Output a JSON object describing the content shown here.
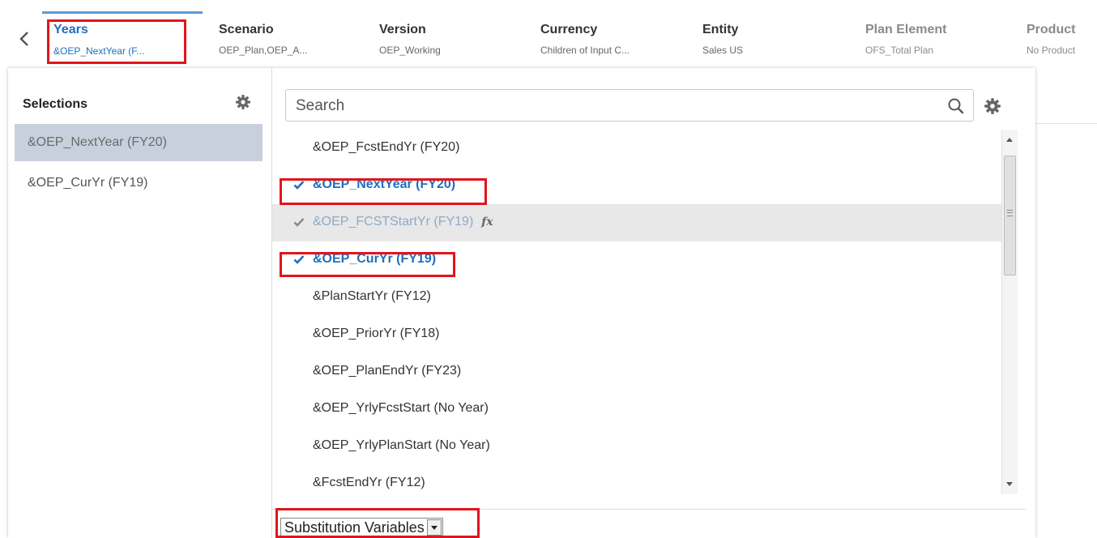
{
  "dimensions": [
    {
      "name": "Years",
      "value": "&OEP_NextYear (F..."
    },
    {
      "name": "Scenario",
      "value": "OEP_Plan,OEP_A..."
    },
    {
      "name": "Version",
      "value": "OEP_Working"
    },
    {
      "name": "Currency",
      "value": "Children of Input C..."
    },
    {
      "name": "Entity",
      "value": "Sales US"
    },
    {
      "name": "Plan Element",
      "value": "OFS_Total Plan"
    },
    {
      "name": "Product",
      "value": "No Product"
    }
  ],
  "selections": {
    "title": "Selections",
    "items": [
      "&OEP_NextYear (FY20)",
      "&OEP_CurYr (FY19)"
    ]
  },
  "search": {
    "placeholder": "Search"
  },
  "members": [
    {
      "label": "&OEP_FcstEndYr (FY20)",
      "checked": false
    },
    {
      "label": "&OEP_NextYear (FY20)",
      "checked": true
    },
    {
      "label": "&OEP_FCSTStartYr (FY19)",
      "checked": true,
      "hover": true,
      "fx": "fx"
    },
    {
      "label": "&OEP_CurYr (FY19)",
      "checked": true
    },
    {
      "label": "&PlanStartYr (FY12)",
      "checked": false
    },
    {
      "label": "&OEP_PriorYr (FY18)",
      "checked": false
    },
    {
      "label": "&OEP_PlanEndYr (FY23)",
      "checked": false
    },
    {
      "label": "&OEP_YrlyFcstStart (No Year)",
      "checked": false
    },
    {
      "label": "&OEP_YrlyPlanStart (No Year)",
      "checked": false
    },
    {
      "label": "&FcstEndYr (FY12)",
      "checked": false
    }
  ],
  "member_filter": {
    "selected": "Substitution Variables"
  },
  "colors": {
    "accent": "#1f6fbf",
    "highlight": "#e2141b",
    "selected_bg": "#c8cfdd"
  }
}
